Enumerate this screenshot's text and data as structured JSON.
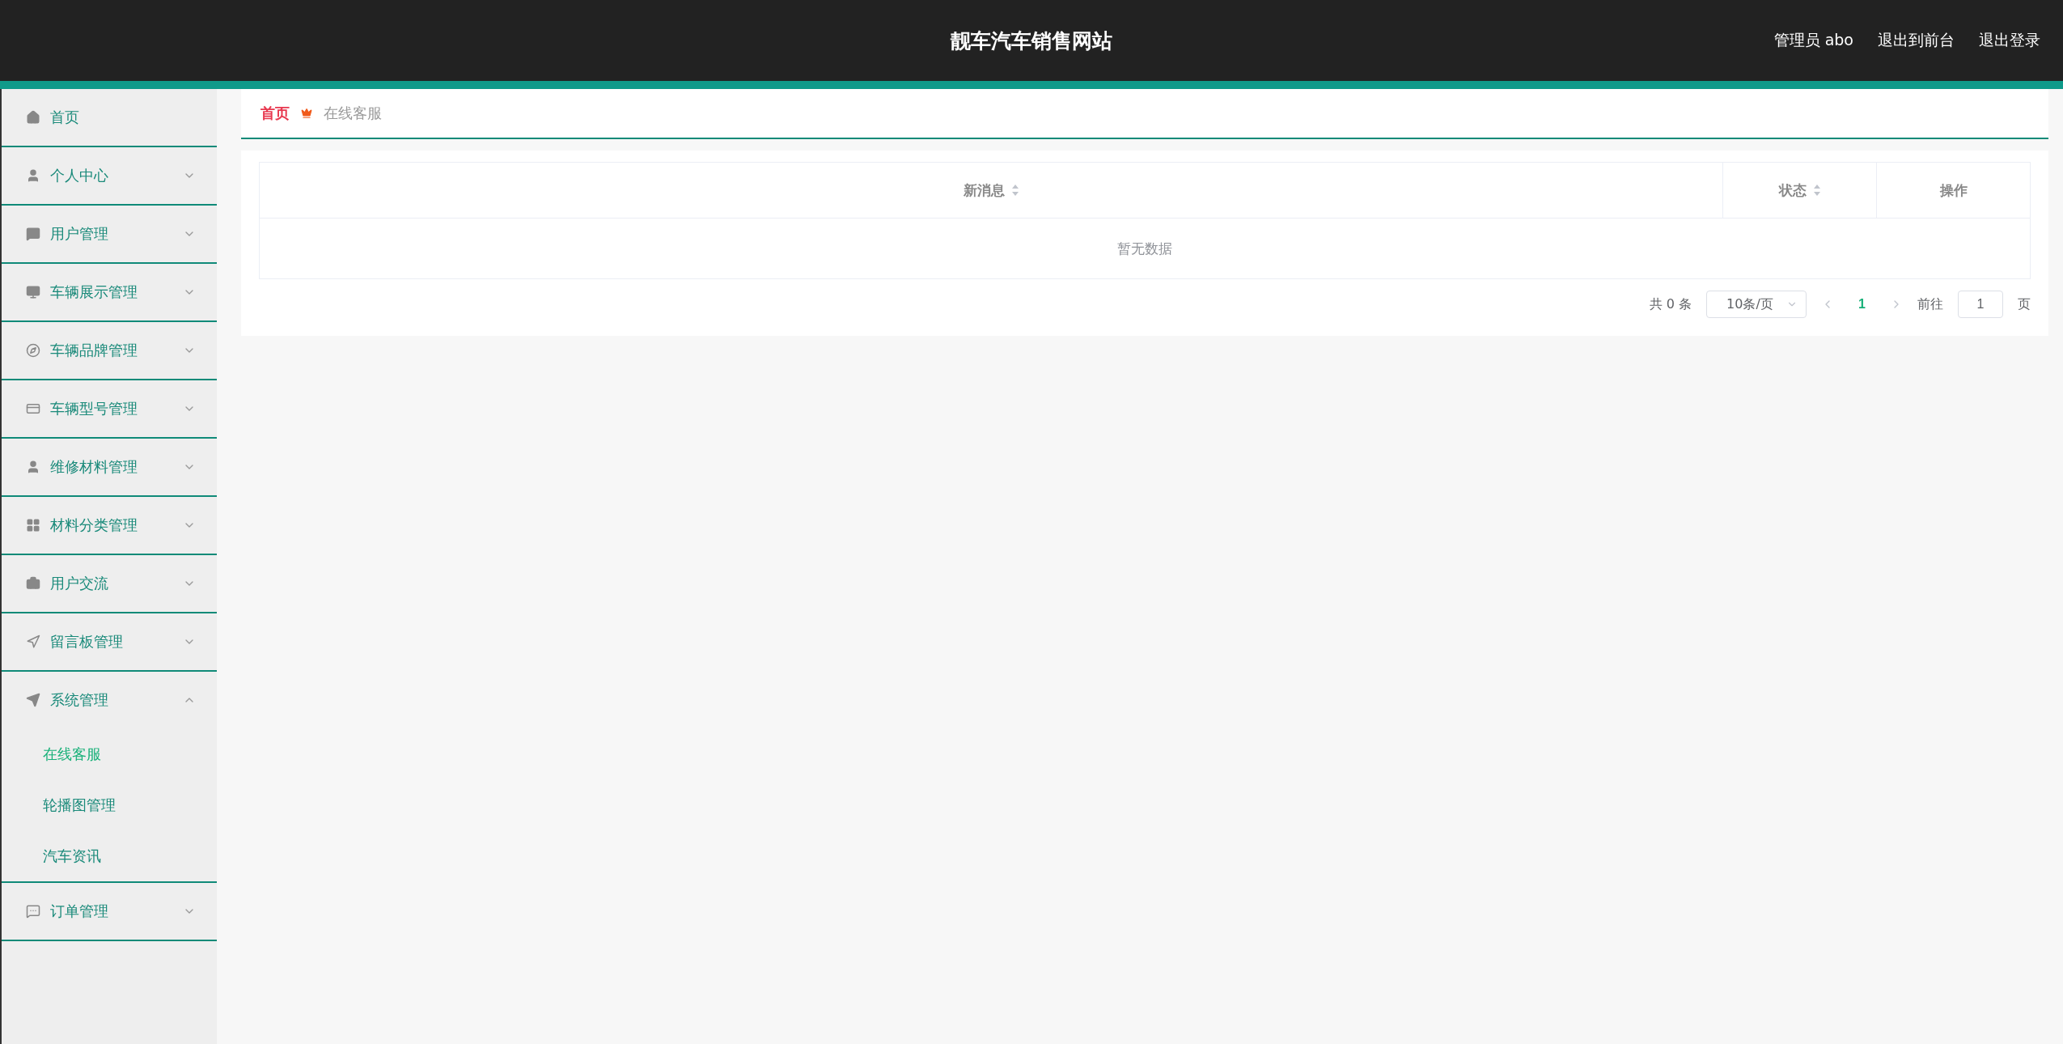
{
  "header": {
    "title": "靓车汽车销售网站",
    "links": [
      "管理员 abo",
      "退出到前台",
      "退出登录"
    ]
  },
  "sidebar": {
    "items": [
      {
        "label": "首页",
        "kind": "link"
      },
      {
        "label": "个人中心",
        "kind": "menu",
        "expanded": false
      },
      {
        "label": "用户管理",
        "kind": "menu",
        "expanded": false
      },
      {
        "label": "车辆展示管理",
        "kind": "menu",
        "expanded": false
      },
      {
        "label": "车辆品牌管理",
        "kind": "menu",
        "expanded": false
      },
      {
        "label": "车辆型号管理",
        "kind": "menu",
        "expanded": false
      },
      {
        "label": "维修材料管理",
        "kind": "menu",
        "expanded": false
      },
      {
        "label": "材料分类管理",
        "kind": "menu",
        "expanded": false
      },
      {
        "label": "用户交流",
        "kind": "menu",
        "expanded": false
      },
      {
        "label": "留言板管理",
        "kind": "menu",
        "expanded": false
      },
      {
        "label": "系统管理",
        "kind": "menu",
        "expanded": true,
        "children": [
          {
            "label": "在线客服",
            "selected": true
          },
          {
            "label": "轮播图管理",
            "selected": false
          },
          {
            "label": "汽车资讯",
            "selected": false
          }
        ]
      },
      {
        "label": "订单管理",
        "kind": "menu",
        "expanded": false
      }
    ]
  },
  "breadcrumb": [
    "首页",
    "在线客服"
  ],
  "table": {
    "columns": [
      {
        "label": "新消息",
        "sortable": true
      },
      {
        "label": "状态",
        "sortable": true
      },
      {
        "label": "操作",
        "sortable": false
      }
    ],
    "empty_text": "暂无数据"
  },
  "pagination": {
    "total": "共 0 条",
    "page_size": "10条/页",
    "pages": [
      {
        "label": "1",
        "selected": true
      }
    ],
    "goto_label": "前往",
    "goto_value": "1",
    "page_suffix": "页"
  }
}
